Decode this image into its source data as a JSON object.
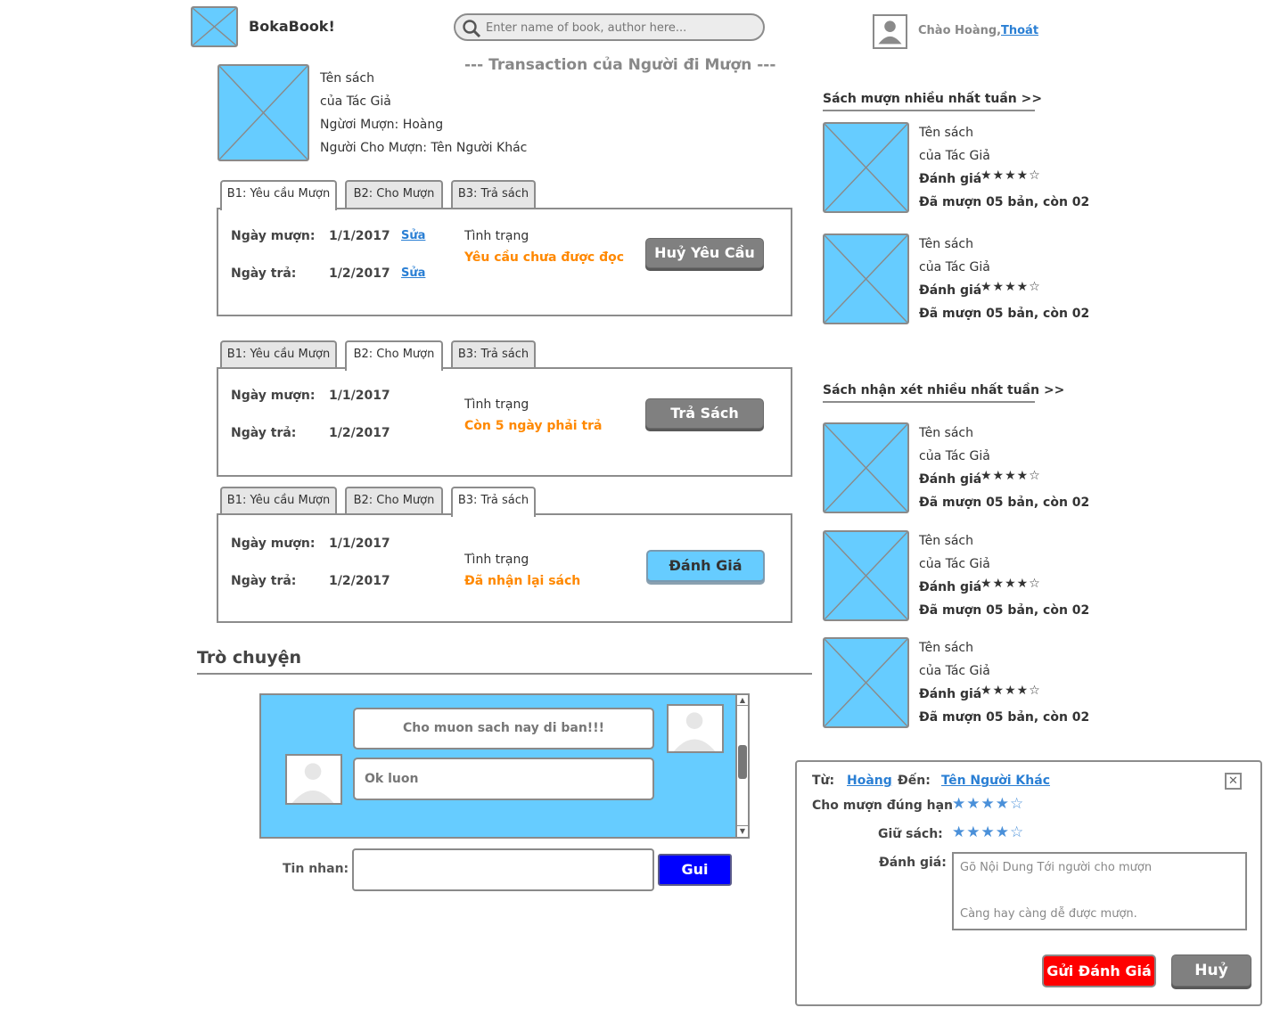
{
  "header": {
    "app_name": "BokaBook!",
    "search_placeholder": "Enter name of book, author here...",
    "greeting": "Chào Hoàng,",
    "logout": "Thoát"
  },
  "transaction": {
    "title": "--- Transaction của Người đi Mượn ---",
    "book_title": "Tên sách",
    "author": "của Tác Giả",
    "borrower": "Ngừơi Mượn: Hoàng",
    "lender": "Người Cho Mượn: Tên Người Khác"
  },
  "tabs": [
    "B1: Yêu cầu Mượn",
    "B2: Cho Mượn",
    "B3: Trả sách"
  ],
  "steps": [
    {
      "borrow_label": "Ngày mượn:",
      "borrow_date": "1/1/2017",
      "return_label": "Ngày trả:",
      "return_date": "1/2/2017",
      "edit": "Sửa",
      "status_label": "Tình trạng",
      "status": "Yêu cầu chưa được đọc",
      "action": "Huỷ Yêu Cầu"
    },
    {
      "borrow_label": "Ngày mượn:",
      "borrow_date": "1/1/2017",
      "return_label": "Ngày trả:",
      "return_date": "1/2/2017",
      "status_label": "Tình trạng",
      "status": "Còn 5 ngày phải trả",
      "action": "Trả Sách"
    },
    {
      "borrow_label": "Ngày mượn:",
      "borrow_date": "1/1/2017",
      "return_label": "Ngày trả:",
      "return_date": "1/2/2017",
      "status_label": "Tình trạng",
      "status": "Đã nhận lại sách",
      "action": "Đánh Giá"
    }
  ],
  "chat": {
    "title": "Trò chuyện",
    "messages": [
      "Cho muon sach nay di ban!!!",
      "Ok luon"
    ],
    "input_label": "Tin nhan:",
    "send": "Gui"
  },
  "sidebar": {
    "most_borrowed_title": "Sách mượn nhiều nhất tuần >>",
    "most_reviewed_title": "Sách nhận xét nhiều nhất tuần >>",
    "book_title": "Tên sách",
    "author": "của Tác Giả",
    "rating_label": "Đánh giá",
    "stars": "★★★★☆",
    "rating": 4,
    "rating_max": 5,
    "stock": "Đã mượn 05 bản, còn 02"
  },
  "review": {
    "from_label": "Từ:",
    "from": "Hoàng",
    "to_label": "Đến:",
    "to": "Tên Người Khác",
    "ontime_label": "Cho mượn đúng hạn",
    "ontime_stars": "★★★★☆",
    "keep_label": "Giữ sách:",
    "keep_stars": "★★★★☆",
    "review_label": "Đánh giá:",
    "placeholder_line1": "Gõ Nội Dung Tới người cho mượn",
    "placeholder_line2": "Càng hay càng dễ được mượn.",
    "submit": "Gửi Đánh Giá",
    "cancel": "Huỷ",
    "close_icon": "✕"
  },
  "colors": {
    "placeholder": "#66ccff",
    "status_orange": "#ff8800",
    "send_button": "#0000ff",
    "submit_button": "#ff0000",
    "star": "#4a90d9",
    "link": "#2a7fd4"
  }
}
